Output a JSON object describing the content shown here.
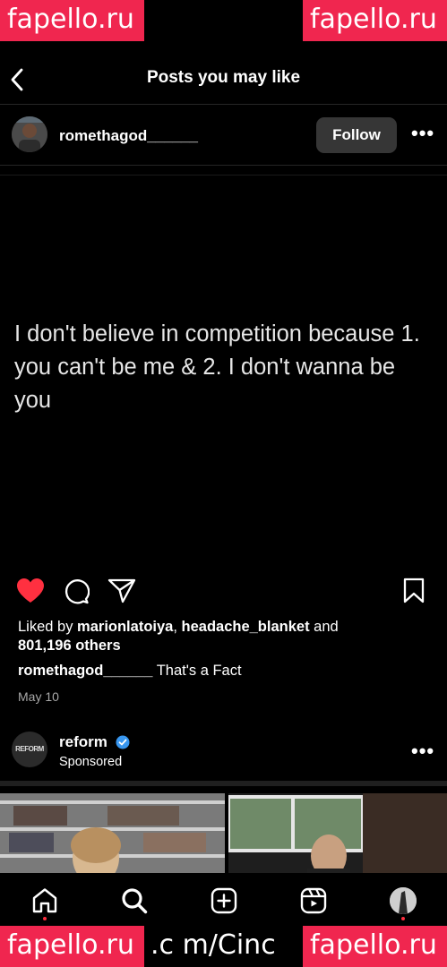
{
  "watermarks": {
    "top_left": "fapello.ru",
    "top_right": "fapello.ru",
    "bottom_left": "fapello.ru",
    "bottom_right": "fapello.ru",
    "bottom_middle": ".c m/Cinc"
  },
  "header": {
    "title": "Posts you may like",
    "back_icon": "chevron-left-icon"
  },
  "post": {
    "username": "romethagod______",
    "follow_label": "Follow",
    "quote": "I don't believe in competition because 1. you can't be me & 2. I don't wanna be you",
    "liked_by_prefix": "Liked by ",
    "liked_user_1": "marionlatoiya",
    "liked_sep": ", ",
    "liked_user_2": "headache_blanket",
    "liked_and": " and",
    "liked_others": "801,196 others",
    "caption_user": "romethagod______",
    "caption_text": "That's a Fact",
    "date": "May 10",
    "liked": true
  },
  "sponsored": {
    "username": "reform",
    "label": "Sponsored",
    "avatar_text": "REFORM",
    "verified": true
  },
  "bottom_nav": {
    "items": [
      "home-icon",
      "search-icon",
      "create-icon",
      "reels-icon",
      "profile-avatar"
    ],
    "active": "search-icon"
  },
  "colors": {
    "like_red": "#ff3040",
    "follow_bg": "#363636",
    "verified_blue": "#3897f0",
    "watermark": "#f0264f"
  }
}
